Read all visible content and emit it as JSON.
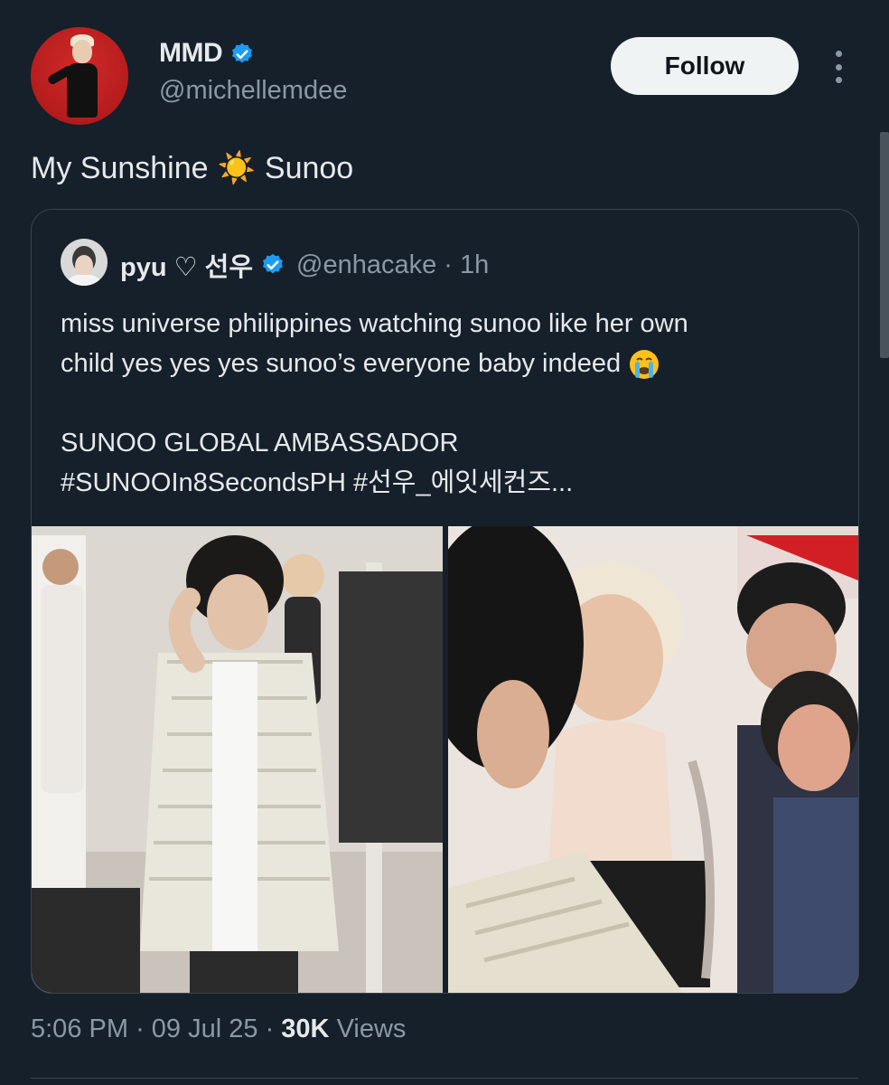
{
  "author": {
    "name": "MMD",
    "handle": "@michellemdee",
    "verified": true
  },
  "follow_button": {
    "label": "Follow"
  },
  "tweet": {
    "text_before": "My Sunshine",
    "emoji": "☀️",
    "text_after": "Sunoo"
  },
  "quoted": {
    "name": "pyu ♡ 선우",
    "handle": "@enhacake",
    "time": "· 1h",
    "line1": "miss universe philippines watching sunoo like her own",
    "line2": "child yes yes yes sunoo’s everyone baby indeed",
    "line3": "SUNOO GLOBAL AMBASSADOR",
    "line4": "#SUNOOIn8SecondsPH #선우_에잇세컨즈..."
  },
  "meta": {
    "time": "5:06 PM",
    "sep1": "·",
    "date": "09 Jul 25",
    "sep2": "·",
    "views_count": "30K",
    "views_label": "Views"
  },
  "colors": {
    "background": "#15202b",
    "verified_blue": "#1d9bf0",
    "muted_text": "#8b98a5"
  }
}
